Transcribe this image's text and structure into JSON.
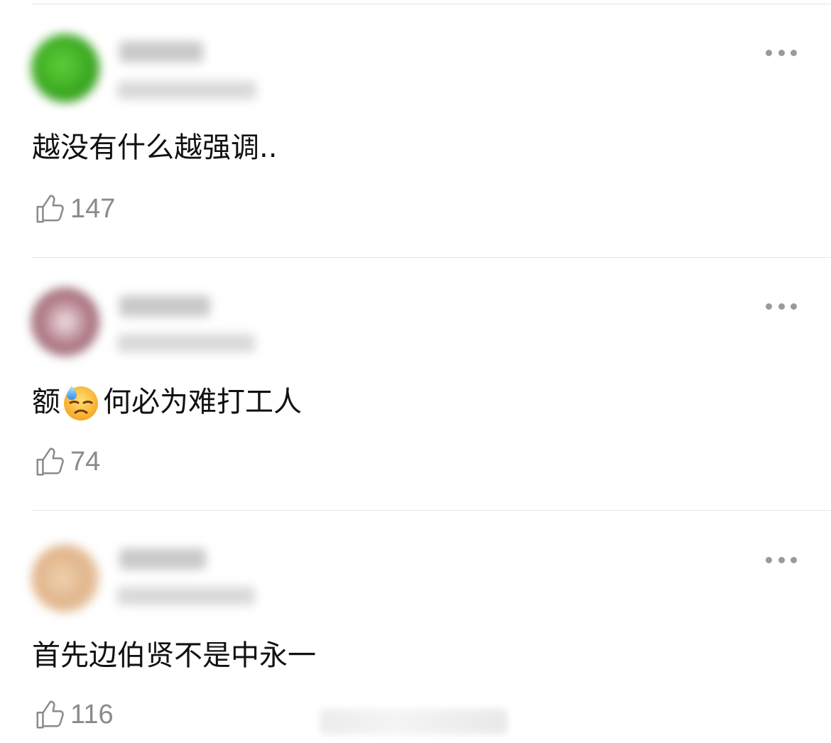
{
  "comments": [
    {
      "text": "越没有什么越强调..",
      "likes": "147",
      "avatar_color": "#3aa820"
    },
    {
      "text_before": "额",
      "emoji": "downcast-face-with-sweat",
      "text_after": "何必为难打工人",
      "likes": "74",
      "avatar_color": "#9a6470"
    },
    {
      "text": "首先边伯贤不是中永一",
      "likes": "116",
      "avatar_color": "#e0b48a"
    }
  ],
  "icons": {
    "like": "thumbs-up-outline-icon",
    "more": "more-dots-icon"
  },
  "colors": {
    "divider": "#e6e6e6",
    "like_count": "#8a8a8a",
    "dots": "#9a9a9a"
  }
}
